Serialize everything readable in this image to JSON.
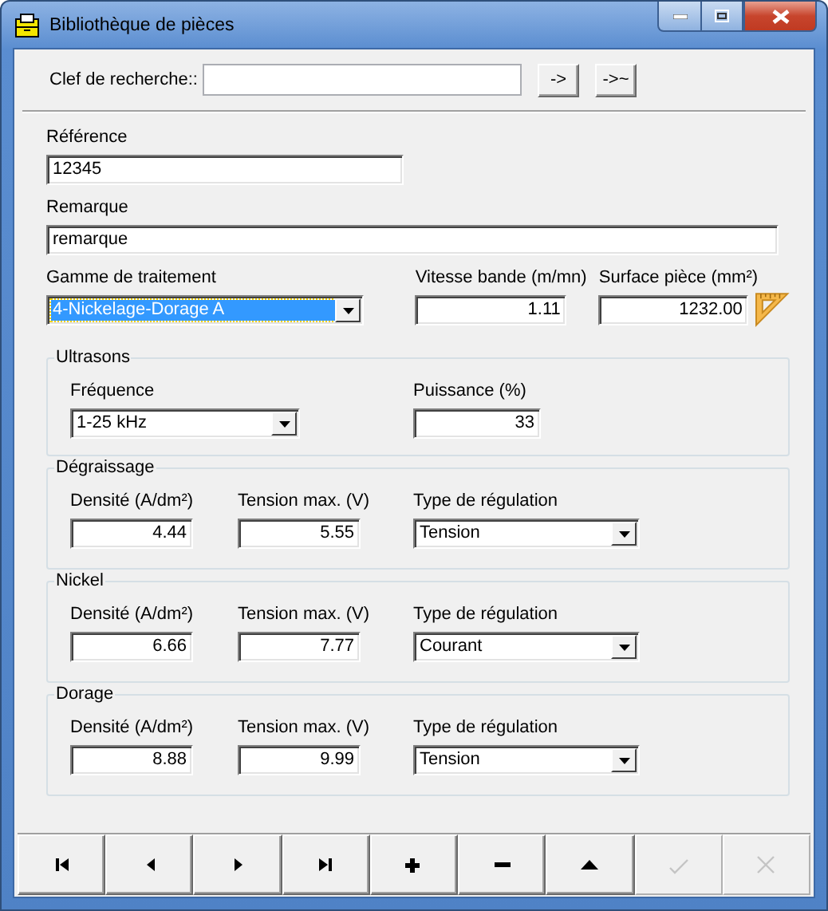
{
  "window": {
    "title": "Bibliothèque de pièces"
  },
  "search": {
    "label": "Clef de recherche::",
    "buttons": [
      "->",
      "->~"
    ]
  },
  "reference": {
    "label": "Référence",
    "value": "12345"
  },
  "remark": {
    "label": "Remarque",
    "value": "remarque"
  },
  "treatment": {
    "label": "Gamme de traitement",
    "value": "4-Nickelage-Dorage A",
    "focused": true
  },
  "speed": {
    "label": "Vitesse bande (m/mn)",
    "value": "1.11"
  },
  "surface": {
    "label": "Surface pièce (mm²)",
    "value": "1232.00"
  },
  "ultrasound": {
    "title": "Ultrasons",
    "frequency": {
      "label": "Fréquence",
      "value": "1-25 kHz"
    },
    "power": {
      "label": "Puissance (%)",
      "value": "33"
    }
  },
  "groups": [
    {
      "title": "Dégraissage",
      "density": {
        "label": "Densité (A/dm²)",
        "value": "4.44"
      },
      "voltage": {
        "label": "Tension max. (V)",
        "value": "5.55"
      },
      "regulation": {
        "label": "Type de régulation",
        "value": "Tension"
      }
    },
    {
      "title": "Nickel",
      "density": {
        "label": "Densité (A/dm²)",
        "value": "6.66"
      },
      "voltage": {
        "label": "Tension max. (V)",
        "value": "7.77"
      },
      "regulation": {
        "label": "Type de régulation",
        "value": "Courant"
      }
    },
    {
      "title": "Dorage",
      "density": {
        "label": "Densité (A/dm²)",
        "value": "8.88"
      },
      "voltage": {
        "label": "Tension max. (V)",
        "value": "9.99"
      },
      "regulation": {
        "label": "Type de régulation",
        "value": "Tension"
      }
    }
  ],
  "nav": [
    {
      "kind": "first",
      "disabled": false
    },
    {
      "kind": "prev",
      "disabled": false
    },
    {
      "kind": "next",
      "disabled": false
    },
    {
      "kind": "last",
      "disabled": false
    },
    {
      "kind": "add",
      "disabled": false
    },
    {
      "kind": "remove",
      "disabled": false
    },
    {
      "kind": "up",
      "disabled": false
    },
    {
      "kind": "confirm",
      "disabled": true
    },
    {
      "kind": "cancel",
      "disabled": true
    }
  ]
}
